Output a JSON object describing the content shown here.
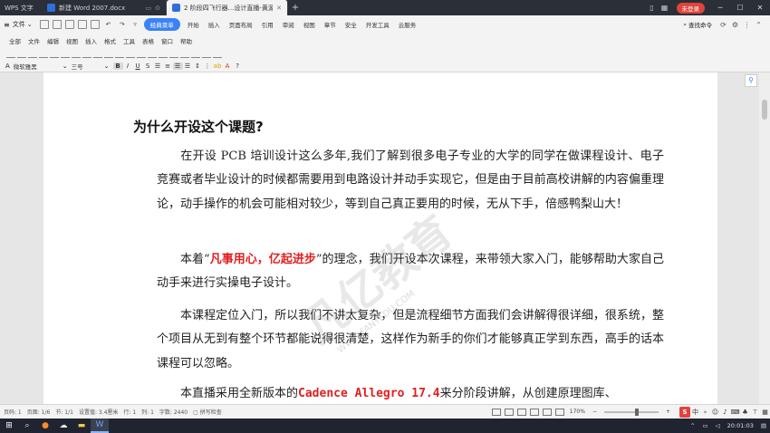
{
  "titlebar": {
    "app_name": "WPS 文字",
    "tabs": [
      {
        "label": "新建 Word 2007.docx"
      },
      {
        "label": "2 阶段四飞行器...设计直播-黄源"
      }
    ],
    "login_label": "未登录"
  },
  "menubar": {
    "file_label": "文件",
    "items": [
      "经典菜单",
      "开始",
      "插入",
      "页面布局",
      "引用",
      "审阅",
      "视图",
      "章节",
      "安全",
      "开发工具",
      "云服务"
    ],
    "search_label": "查找命令"
  },
  "toolbar1": {
    "items": [
      "全部",
      "文件",
      "编辑",
      "视图",
      "插入",
      "格式",
      "工具",
      "表格",
      "窗口",
      "帮助"
    ]
  },
  "toolbar3": {
    "font_name": "微软雅黑",
    "font_size": "三号",
    "bold": "B",
    "italic": "I",
    "underline": "U",
    "strike": "S"
  },
  "document": {
    "heading": "为什么开设这个课题?",
    "p1": "在开设 PCB 培训设计这么多年,我们了解到很多电子专业的大学的同学在做课程设计、电子竞赛或者毕业设计的时候都需要用到电路设计并动手实现它，但是由于目前高校讲解的内容偏重理论，动手操作的机会可能相对较少，等到自己真正要用的时候，无从下手，倍感鸭梨山大！",
    "p2_before": "本着“",
    "p2_red": "凡事用心，亿起进步",
    "p2_after": "”的理念，我们开设本次课程，来带领大家入门，能够帮助大家自己动手来进行实操电子设计。",
    "p3": "本课程定位入门，所以我们不讲太复杂，但是流程细节方面我们会讲解得很详细，很系统，整个项目从无到有整个环节都能说得很清楚，这样作为新手的你们才能够真正学到东西，高手的话本课程可以忽略。",
    "p4_before": "本直播采用全新版本的",
    "p4_red": "Cadence Allegro 17.4",
    "p4_after": "来分阶段讲解，从创建原理图库、",
    "watermark": "凡亿教育",
    "watermark_url": "WWW.FANYEDU.COM"
  },
  "statusbar": {
    "page_no": "页码: 1",
    "pages": "页面: 1/6",
    "section": "节: 1/1",
    "setting": "设置值: 3.4厘米",
    "row": "行: 1",
    "col": "列: 1",
    "words": "字数: 2440",
    "spell": "拼写检查",
    "zoom": "170%"
  },
  "ime": {
    "label": "中"
  },
  "taskbar": {
    "time": "20:01:03"
  }
}
